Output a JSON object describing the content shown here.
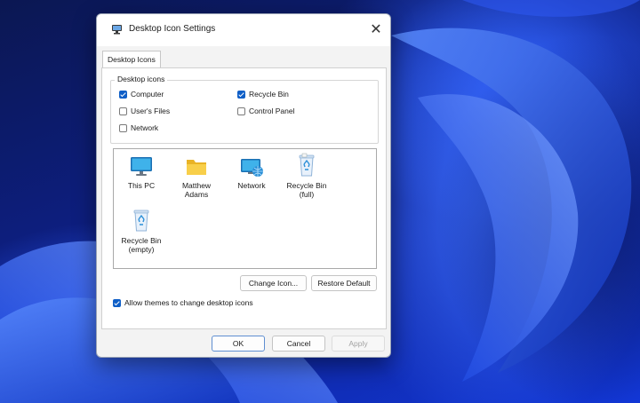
{
  "dialog": {
    "title": "Desktop Icon Settings",
    "title_icon": "desktop-settings-icon",
    "close_glyph": "✕"
  },
  "tabs": [
    {
      "label": "Desktop Icons",
      "selected": true
    }
  ],
  "desktop_icons_group": {
    "legend": "Desktop icons",
    "checkboxes": [
      {
        "label": "Computer",
        "checked": true
      },
      {
        "label": "Recycle Bin",
        "checked": true
      },
      {
        "label": "User's Files",
        "checked": false
      },
      {
        "label": "Control Panel",
        "checked": false
      },
      {
        "label": "Network",
        "checked": false
      }
    ]
  },
  "icon_list": [
    {
      "label_lines": [
        "This PC"
      ],
      "icon": "monitor-icon"
    },
    {
      "label_lines": [
        "Matthew",
        "Adams"
      ],
      "icon": "folder-icon"
    },
    {
      "label_lines": [
        "Network"
      ],
      "icon": "network-icon"
    },
    {
      "label_lines": [
        "Recycle Bin",
        "(full)"
      ],
      "icon": "recycle-bin-full-icon"
    },
    {
      "label_lines": [
        "Recycle Bin",
        "(empty)"
      ],
      "icon": "recycle-bin-empty-icon"
    }
  ],
  "buttons": {
    "change_icon": "Change Icon...",
    "restore_default": "Restore Default",
    "ok": "OK",
    "cancel": "Cancel",
    "apply": "Apply",
    "apply_enabled": false
  },
  "allow_themes": {
    "label": "Allow themes to change desktop icons",
    "checked": true
  },
  "colors": {
    "accent": "#0f5fc7",
    "wallpaper": "#1237d6",
    "dialog_bg": "#f3f3f3"
  }
}
